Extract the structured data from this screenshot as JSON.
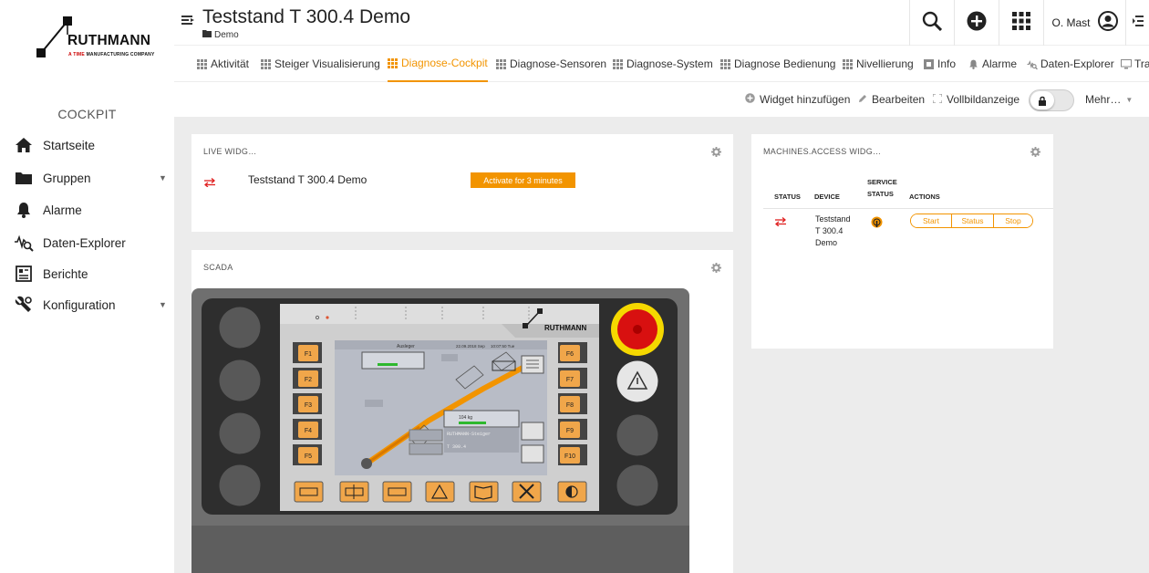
{
  "brand": {
    "name": "RUTHMANN",
    "subline_time": "A TIME",
    "subline_rest": "MANUFACTURING COMPANY"
  },
  "sidebar": {
    "section_label": "COCKPIT",
    "items": [
      {
        "label": "Startseite",
        "icon": "home-icon"
      },
      {
        "label": "Gruppen",
        "icon": "folder-icon",
        "expandable": true
      },
      {
        "label": "Alarme",
        "icon": "bell-icon"
      },
      {
        "label": "Daten-Explorer",
        "icon": "data-explorer-icon"
      },
      {
        "label": "Berichte",
        "icon": "reports-icon"
      },
      {
        "label": "Konfiguration",
        "icon": "wrench-icon",
        "expandable": true
      }
    ]
  },
  "header": {
    "title": "Teststand T 300.4 Demo",
    "breadcrumb": "Demo",
    "user": "O. Mast"
  },
  "tabs": [
    {
      "label": "Aktivität",
      "icon": "grid-icon"
    },
    {
      "label": "Steiger Visualisierung",
      "icon": "grid-icon"
    },
    {
      "label": "Diagnose-Cockpit",
      "icon": "grid-icon",
      "active": true
    },
    {
      "label": "Diagnose-Sensoren",
      "icon": "grid-icon"
    },
    {
      "label": "Diagnose-System",
      "icon": "grid-icon"
    },
    {
      "label": "Diagnose Bedienung",
      "icon": "grid-icon"
    },
    {
      "label": "Nivellierung",
      "icon": "grid-icon"
    },
    {
      "label": "Info",
      "icon": "info-icon"
    },
    {
      "label": "Alarme",
      "icon": "bell-icon"
    },
    {
      "label": "Daten-Explorer",
      "icon": "data-explorer-icon"
    },
    {
      "label": "Tra",
      "icon": "monitor-icon"
    }
  ],
  "toolbar": {
    "add_widget": "Widget hinzufügen",
    "edit": "Bearbeiten",
    "fullscreen": "Vollbildanzeige",
    "more": "Mehr…"
  },
  "live_widget": {
    "title": "LIVE WIDG…",
    "device": "Teststand T 300.4 Demo",
    "activate_label": "Activate for 3 minutes"
  },
  "scada": {
    "title": "SCADA",
    "screen_brand": "RUTHMANN",
    "screen_header_left": "Ausleger",
    "screen_header_mid": "22.09.2018 Sep",
    "screen_header_right": "10:07:50 Tue",
    "load_value": "104 kg",
    "model_line1": "RUTHMANN-Steiger",
    "model_line2": "T 300.4",
    "left_keys": [
      "F1",
      "F2",
      "F3",
      "F4",
      "F5"
    ],
    "right_keys": [
      "F6",
      "F7",
      "F8",
      "F9",
      "F10"
    ]
  },
  "machines_access": {
    "title": "MACHINES.ACCESS WIDG…",
    "columns": [
      "STATUS",
      "DEVICE",
      "SERVICE STATUS",
      "ACTIONS"
    ],
    "service_status_line1": "SERVICE",
    "service_status_line2": "STATUS",
    "row": {
      "device_line1": "Teststand",
      "device_line2": "T 300.4",
      "device_line3": "Demo",
      "actions": [
        "Start",
        "Status",
        "Stop"
      ]
    }
  },
  "colors": {
    "accent": "#f29400",
    "alarm_red": "#e02020",
    "content_bg": "#ececec"
  }
}
